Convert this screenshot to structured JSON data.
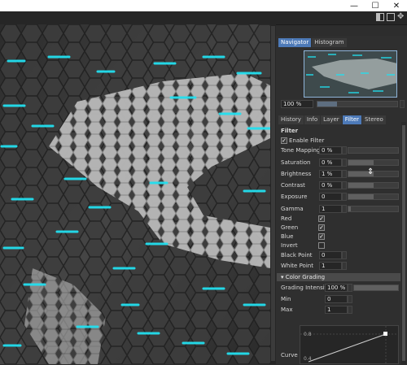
{
  "window": {
    "controls": [
      {
        "name": "minimize",
        "glyph": "—"
      },
      {
        "name": "maximize",
        "glyph": "☐"
      },
      {
        "name": "close",
        "glyph": "✕"
      }
    ]
  },
  "toolbar": {
    "icons": [
      "split-view-icon",
      "panel-layout-icon",
      "move-icon"
    ]
  },
  "panel_top": {
    "tabs": [
      {
        "label": "Navigator",
        "active": true
      },
      {
        "label": "Histogram",
        "active": false
      }
    ],
    "zoom_value": "100 %"
  },
  "panel_tabs": [
    {
      "label": "History",
      "active": false
    },
    {
      "label": "Info",
      "active": false
    },
    {
      "label": "Layer",
      "active": false
    },
    {
      "label": "Filter",
      "active": true
    },
    {
      "label": "Stereo",
      "active": false
    }
  ],
  "filter": {
    "heading": "Filter",
    "enable_label": "Enable Filter",
    "enable_checked": true,
    "sliders": [
      {
        "label": "Tone Mapping",
        "value": "0 %",
        "level": 0.0
      },
      {
        "label": "Saturation",
        "value": "0 %",
        "level": 0.5
      },
      {
        "label": "Brightness",
        "value": "1 %",
        "level": 0.5
      },
      {
        "label": "Contrast",
        "value": "0 %",
        "level": 0.5
      },
      {
        "label": "Exposure",
        "value": "0",
        "level": 0.5
      },
      {
        "label": "Gamma",
        "value": "1",
        "level": 0.05
      }
    ],
    "channels": [
      {
        "label": "Red",
        "checked": true
      },
      {
        "label": "Green",
        "checked": true
      },
      {
        "label": "Blue",
        "checked": true
      },
      {
        "label": "Invert",
        "checked": false
      }
    ],
    "black_point": {
      "label": "Black Point",
      "value": "0"
    },
    "white_point": {
      "label": "White Point",
      "value": "1"
    }
  },
  "color_grading": {
    "section_label": "Color Grading",
    "intensity": {
      "label": "Grading Intensity",
      "value": "100 %",
      "level": 1.0
    },
    "min": {
      "label": "Min",
      "value": "0"
    },
    "max": {
      "label": "Max",
      "value": "1"
    },
    "curve_label": "Curve",
    "curve_ticks": [
      "0.8",
      "0.4"
    ]
  },
  "colors": {
    "accent": "#4d7ab8",
    "glow": "#22e0f0"
  }
}
